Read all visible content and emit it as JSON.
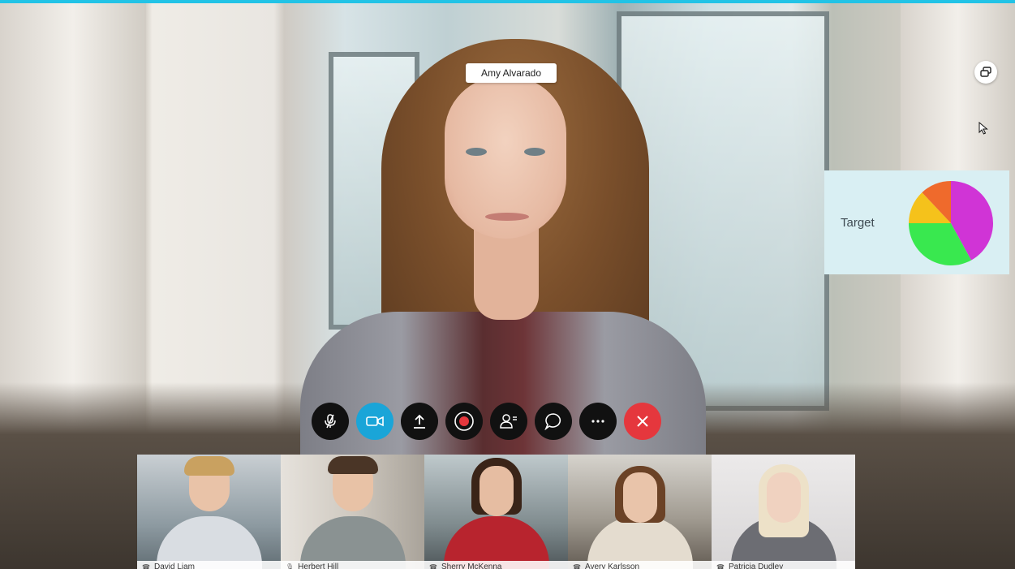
{
  "active_speaker": {
    "name": "Amy Alvarado"
  },
  "layout_button": {
    "icon": "layout-switch-icon"
  },
  "shared_chart": {
    "label": "Target",
    "chart_data": {
      "type": "pie",
      "title": "",
      "slices": [
        {
          "value": 42,
          "color": "#d034d6"
        },
        {
          "value": 33,
          "color": "#39e84f"
        },
        {
          "value": 13,
          "color": "#f5c21b"
        },
        {
          "value": 12,
          "color": "#ef6a2c"
        }
      ]
    }
  },
  "controls": [
    {
      "icon": "mic-muted-icon",
      "style": "dark"
    },
    {
      "icon": "video-camera-icon",
      "style": "blue"
    },
    {
      "icon": "share-upload-icon",
      "style": "dark"
    },
    {
      "icon": "record-icon",
      "style": "dark"
    },
    {
      "icon": "participants-icon",
      "style": "dark"
    },
    {
      "icon": "chat-icon",
      "style": "dark"
    },
    {
      "icon": "more-icon",
      "style": "dark"
    },
    {
      "icon": "end-call-icon",
      "style": "red"
    }
  ],
  "participants": [
    {
      "name": "David Liam"
    },
    {
      "name": "Herbert Hill"
    },
    {
      "name": "Sherry McKenna"
    },
    {
      "name": "Avery Karlsson"
    },
    {
      "name": "Patricia Dudley"
    }
  ]
}
